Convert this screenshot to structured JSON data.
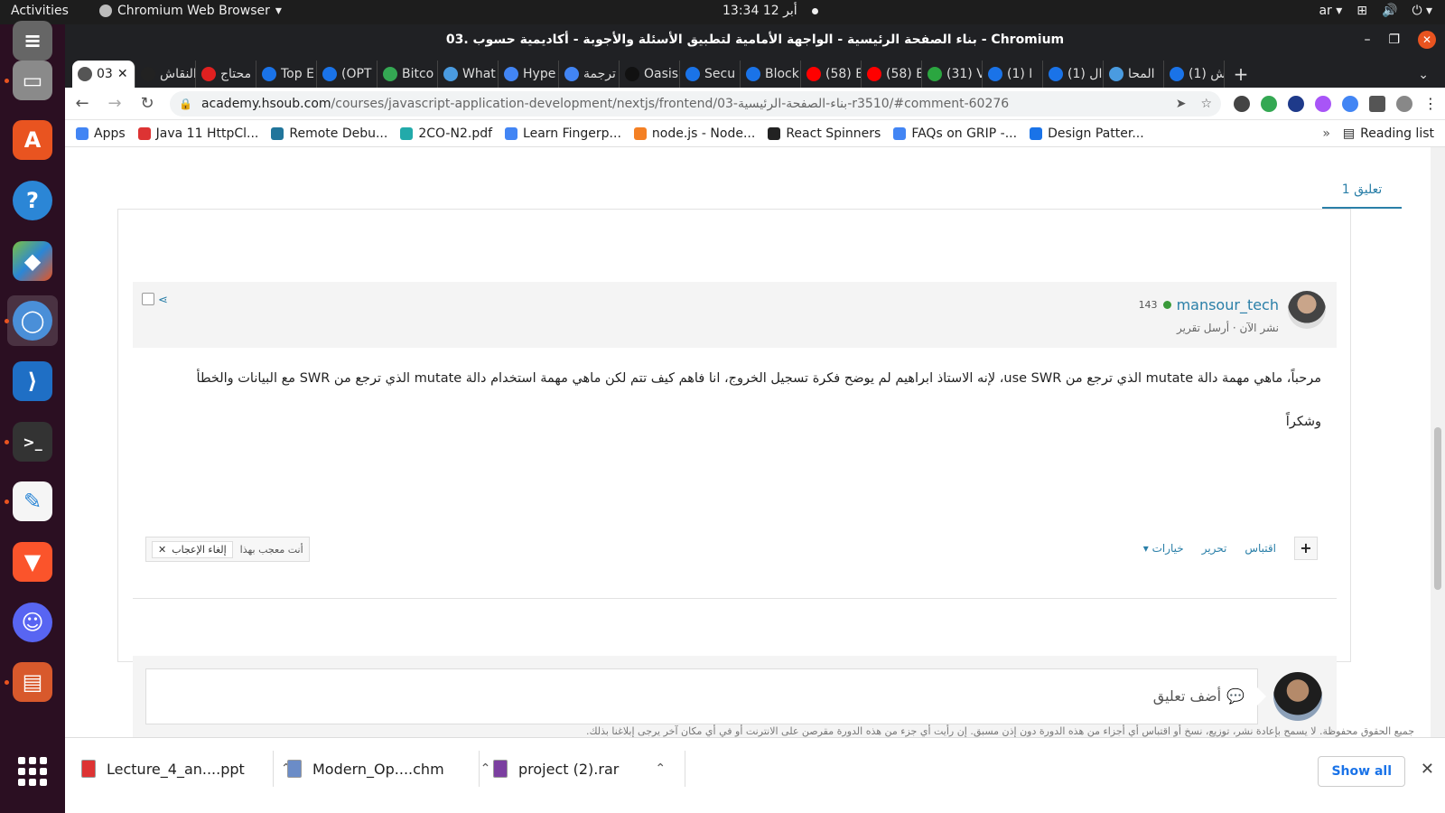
{
  "topbar": {
    "activities": "Activities",
    "app_menu": "Chromium Web Browser",
    "clock": "أبر 12  13:34",
    "lang": "ar"
  },
  "window": {
    "title": "03. بناء الصفحة الرئيسية - الواجهة الأمامية لتطبيق الأسئلة والأجوبة - أكاديمية حسوب - Chromium"
  },
  "tabs": [
    {
      "label": "03",
      "color": "#555555"
    },
    {
      "label": "النقاش",
      "color": "#222222"
    },
    {
      "label": "محتاج",
      "color": "#e02020"
    },
    {
      "label": "Top E",
      "color": "#1a73e8"
    },
    {
      "label": "(OPT",
      "color": "#1a73e8"
    },
    {
      "label": "Bitco",
      "color": "#34a853"
    },
    {
      "label": "What",
      "color": "#4a9be0"
    },
    {
      "label": "Hype",
      "color": "#4285f4"
    },
    {
      "label": "ترجمة",
      "color": "#4285f4"
    },
    {
      "label": "Oasis",
      "color": "#111111"
    },
    {
      "label": "Secu",
      "color": "#1a73e8"
    },
    {
      "label": "Block",
      "color": "#1a73e8"
    },
    {
      "label": "(58) E",
      "color": "#ff0000"
    },
    {
      "label": "(58) E",
      "color": "#ff0000"
    },
    {
      "label": "(31) V",
      "color": "#2ba640"
    },
    {
      "label": "(1) ا",
      "color": "#1a73e8"
    },
    {
      "label": "(1) ال",
      "color": "#1a73e8"
    },
    {
      "label": "المحا",
      "color": "#4a9be0"
    },
    {
      "label": "(1) ش",
      "color": "#1a73e8"
    }
  ],
  "address": {
    "domain": "academy.hsoub.com",
    "path": "/courses/javascript-application-development/nextjs/frontend/03-بناء-الصفحة-الرئيسية-r3510/#comment-60276"
  },
  "bookmarks": [
    {
      "label": "Apps",
      "color": "#4285f4"
    },
    {
      "label": "Java 11 HttpCl...",
      "color": "#d33"
    },
    {
      "label": "Remote Debu...",
      "color": "#21759b"
    },
    {
      "label": "2CO-N2.pdf",
      "color": "#2aa"
    },
    {
      "label": "Learn Fingerp...",
      "color": "#4285f4"
    },
    {
      "label": "node.js - Node...",
      "color": "#f48024"
    },
    {
      "label": "React Spinners",
      "color": "#222"
    },
    {
      "label": "FAQs on GRIP -...",
      "color": "#4285f4"
    },
    {
      "label": "Design Patter...",
      "color": "#1a73e8"
    }
  ],
  "reading_list": "Reading list",
  "comments_tab": "1 تعليق",
  "comment": {
    "author": "mansour_tech",
    "reputation": "143",
    "meta": "نشر الآن · أرسل تقرير",
    "line1": "مرحباً، ماهي مهمة دالة mutate الذي ترجع من use SWR، لإنه الاستاذ ابراهيم لم يوضح فكرة تسجيل الخروج، انا فاهم كيف تتم لكن ماهي مهمة استخدام دالة mutate الذي ترجع من SWR مع البيانات والخطأ",
    "line2": "وشكراً",
    "liked_text": "أنت معجب بهذا",
    "unlike": "إلغاء الإعجاب",
    "actions": {
      "quote": "اقتباس",
      "edit": "تحرير",
      "options": "خيارات"
    }
  },
  "reply": {
    "placeholder": "أضف تعليق"
  },
  "footer_note": "جميع الحقوق محفوظة. لا يسمح بإعادة نشر، توزيع، نسخ أو اقتباس أي أجزاء من هذه الدورة دون إذن مسبق. إن رأيت أي جزء من هذه الدورة مقرصن على الانترنت أو في أي مكان آخر يرجى إبلاغنا بذلك.",
  "downloads": [
    {
      "name": "Lecture_4_an....ppt",
      "color": "#d33"
    },
    {
      "name": "Modern_Op....chm",
      "color": "#6b8cc7"
    },
    {
      "name": "project (2).rar",
      "color": "#7b3fa0"
    }
  ],
  "show_all": "Show all"
}
